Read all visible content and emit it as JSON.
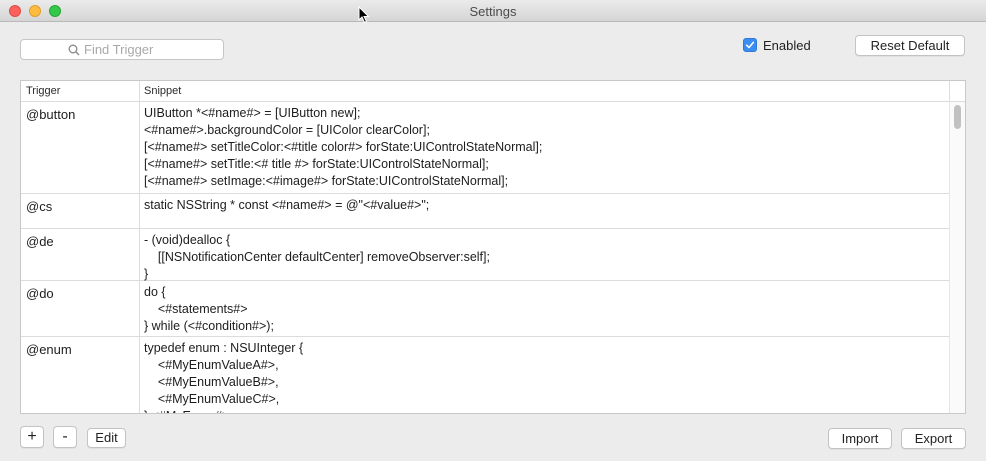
{
  "window": {
    "title": "Settings"
  },
  "search": {
    "placeholder": "Find Trigger",
    "value": ""
  },
  "enabled": {
    "label": "Enabled",
    "checked": true
  },
  "buttons": {
    "reset": "Reset Default",
    "add": "+",
    "remove": "-",
    "edit": "Edit",
    "import": "Import",
    "export": "Export"
  },
  "table": {
    "columns": [
      "Trigger",
      "Snippet"
    ],
    "rows": [
      {
        "trigger": "@button",
        "snippet": "UIButton *<#name#> = [UIButton new];\n<#name#>.backgroundColor = [UIColor clearColor];\n[<#name#> setTitleColor:<#title color#> forState:UIControlStateNormal];\n[<#name#> setTitle:<# title #> forState:UIControlStateNormal];\n[<#name#> setImage:<#image#> forState:UIControlStateNormal];"
      },
      {
        "trigger": "@cs",
        "snippet": "static NSString * const <#name#> = @\"<#value#>\";"
      },
      {
        "trigger": "@de",
        "snippet": "- (void)dealloc {\n    [[NSNotificationCenter defaultCenter] removeObserver:self];\n}"
      },
      {
        "trigger": "@do",
        "snippet": "do {\n    <#statements#>\n} while (<#condition#>);"
      },
      {
        "trigger": "@enum",
        "snippet": "typedef enum : NSUInteger {\n    <#MyEnumValueA#>,\n    <#MyEnumValueB#>,\n    <#MyEnumValueC#>,\n} <#MyEnum#>;"
      }
    ]
  },
  "colors": {
    "accent": "#3b8df2",
    "close": "#fc605c",
    "minimize": "#fdbc40",
    "maximize": "#34c84a"
  }
}
